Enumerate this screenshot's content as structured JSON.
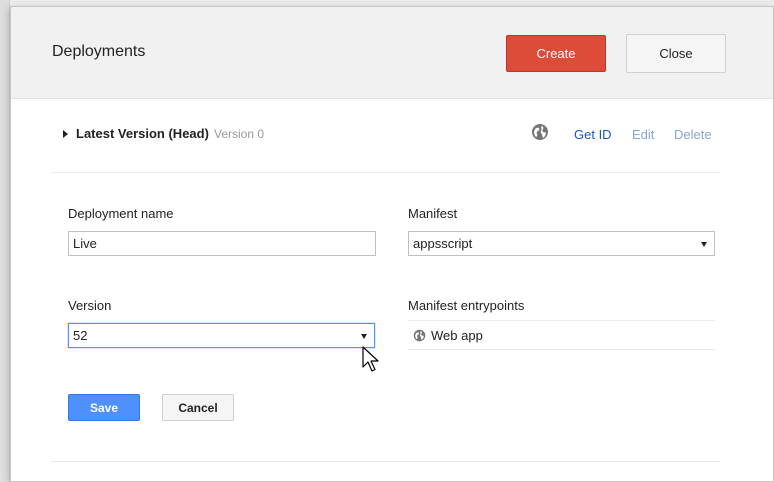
{
  "dialog": {
    "title": "Deployments",
    "create_label": "Create",
    "close_label": "Close"
  },
  "version_row": {
    "title": "Latest Version (Head)",
    "subtitle": "Version 0",
    "icon": "globe-icon",
    "actions": {
      "get_id": "Get ID",
      "edit": "Edit",
      "delete": "Delete"
    }
  },
  "form": {
    "deployment_name_label": "Deployment name",
    "deployment_name_value": "Live",
    "manifest_label": "Manifest",
    "manifest_value": "appsscript",
    "version_label": "Version",
    "version_value": "52",
    "entrypoints_label": "Manifest entrypoints",
    "entrypoint": {
      "icon": "globe-icon",
      "label": "Web app"
    },
    "save_label": "Save",
    "cancel_label": "Cancel"
  },
  "colors": {
    "create": "#dd4b39",
    "save": "#4d90fe",
    "link": "#1a55c4",
    "link_muted": "#8aa4d6"
  }
}
